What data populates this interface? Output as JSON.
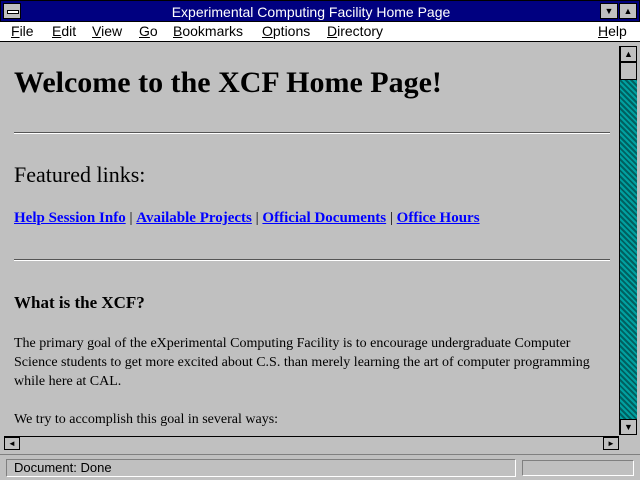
{
  "window": {
    "title": "Experimental Computing Facility Home Page"
  },
  "menu": {
    "file": "File",
    "edit": "Edit",
    "view": "View",
    "go": "Go",
    "bookmarks": "Bookmarks",
    "options": "Options",
    "directory": "Directory",
    "help": "Help"
  },
  "page": {
    "heading": "Welcome to the XCF Home Page!",
    "featured_heading": "Featured links:",
    "links": [
      "Help Session Info",
      "Available Projects",
      "Official Documents",
      "Office Hours"
    ],
    "separator": " | ",
    "subheading": "What is the XCF?",
    "paragraph1": "The primary goal of the eXperimental Computing Facility is to encourage undergraduate Computer Science students to get more excited about C.S. than merely learning the art of computer programming while here at CAL.",
    "paragraph2": "We try to accomplish this goal in several ways:"
  },
  "status": {
    "text": "Document: Done"
  },
  "colors": {
    "titlebar": "#000080",
    "link": "#0000ff",
    "background": "#c0c0c0",
    "scrollbar": "#008080"
  },
  "icons": {
    "system_menu": "system-menu-icon",
    "minimize": "minimize-arrow-icon",
    "maximize": "maximize-arrow-icon"
  }
}
